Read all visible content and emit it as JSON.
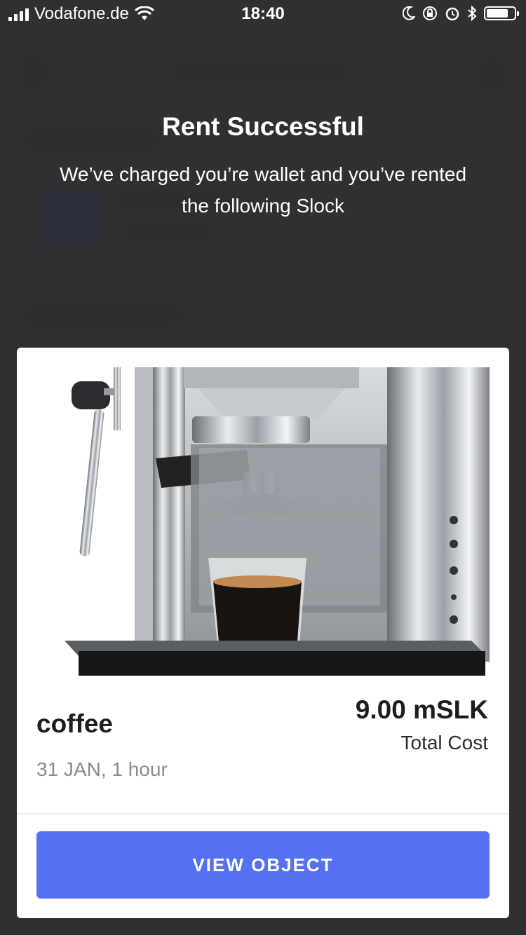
{
  "status_bar": {
    "carrier": "Vodafone.de",
    "time": "18:40",
    "icons": [
      "signal-icon",
      "wifi-icon",
      "moon-icon",
      "rotation-lock-icon",
      "alarm-icon",
      "bluetooth-icon",
      "battery-icon"
    ]
  },
  "dialog": {
    "title": "Rent Successful",
    "message": "We’ve charged you’re wallet and you’ve rented the following Slock"
  },
  "card": {
    "image_alt": "espresso-machine",
    "name": "coffee",
    "meta": "31 JAN, 1 hour",
    "price": "9.00 mSLK",
    "price_label": "Total Cost",
    "button_label": "VIEW OBJECT"
  },
  "colors": {
    "accent": "#5570f1",
    "overlay": "#3a3a3c"
  }
}
